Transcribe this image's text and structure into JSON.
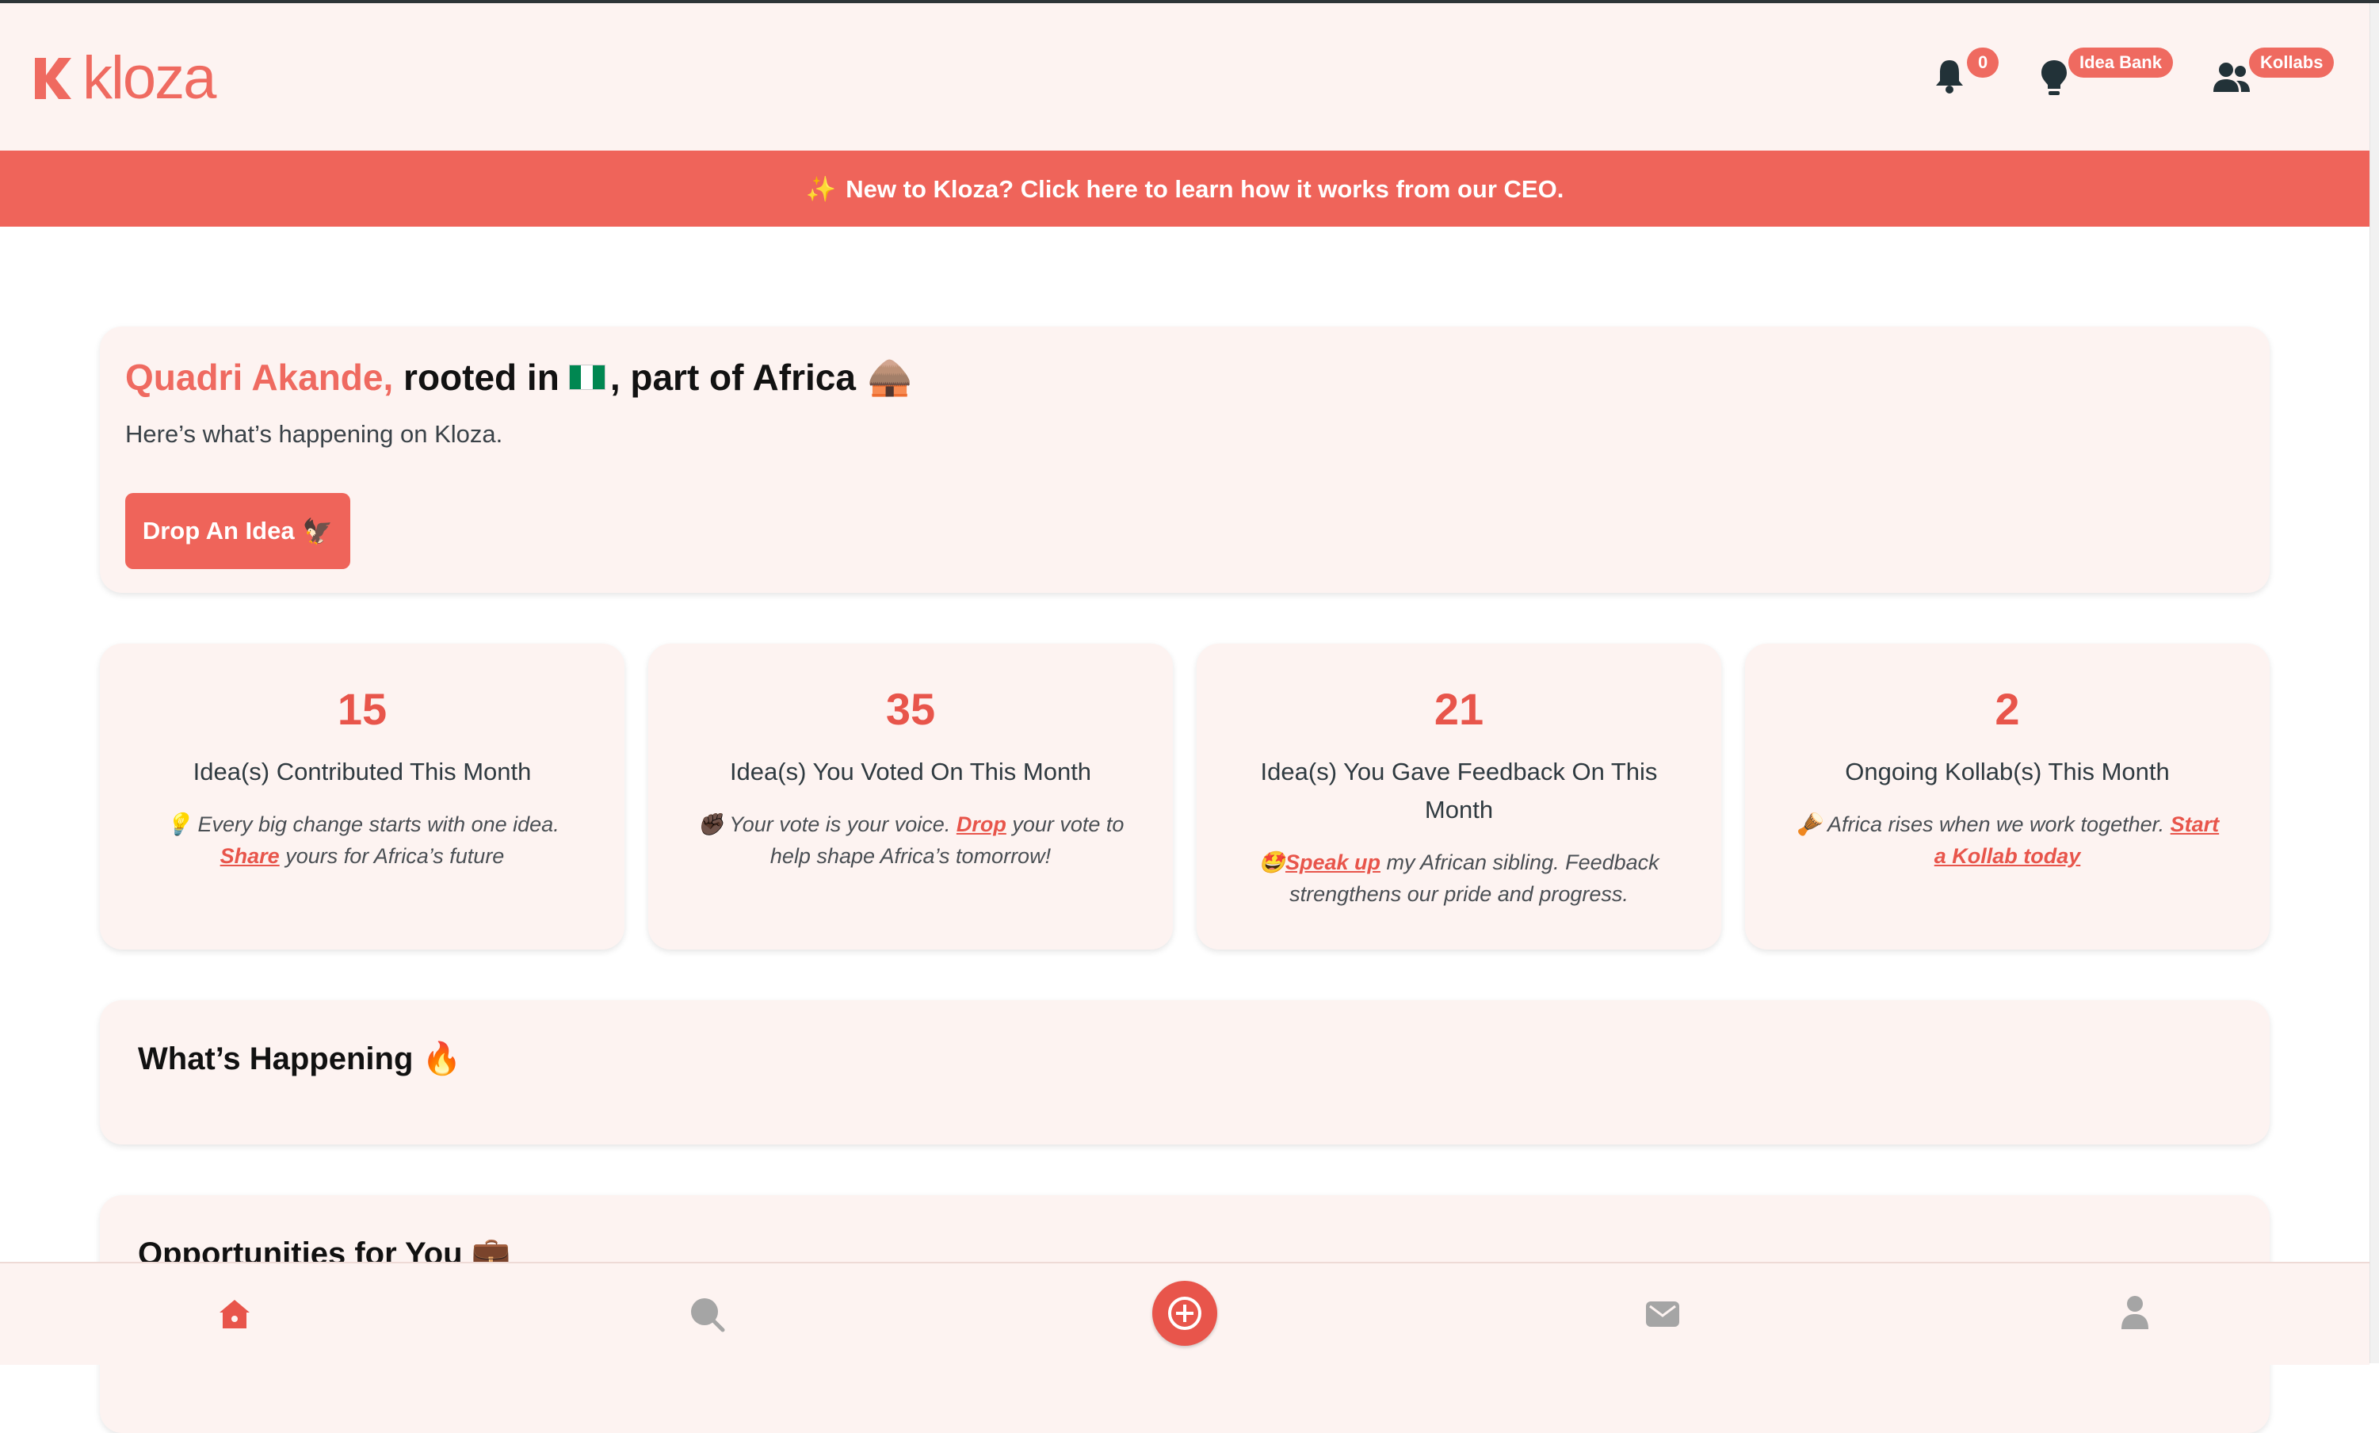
{
  "brand": {
    "name": "kloza",
    "color": "#ef6a60"
  },
  "header": {
    "notifications": {
      "icon": "bell-icon",
      "count": "0"
    },
    "idea_bank": {
      "icon": "lightbulb-icon",
      "label": "Idea Bank"
    },
    "kollabs": {
      "icon": "users-icon",
      "label": "Kollabs"
    }
  },
  "banner": {
    "text": "New to Kloza? Click here to learn how it works from our CEO.",
    "sparkle": "✨"
  },
  "welcome": {
    "name": "Quadri Akande,",
    "rooted": "rooted in",
    "africa": ", part of Africa",
    "hut": "🛖",
    "subtitle": "Here’s what’s happening on Kloza.",
    "drop_button": "Drop An Idea",
    "drop_icon": "🦅"
  },
  "stats": [
    {
      "value": "15",
      "label": "Idea(s) Contributed This Month",
      "icon": "💡",
      "pre": "Every big change starts with one idea.",
      "link": "Share",
      "post": "yours for Africa’s future"
    },
    {
      "value": "35",
      "label": "Idea(s) You Voted On This Month",
      "icon": "✊🏿",
      "pre": "Your vote is your voice.",
      "link": "Drop",
      "post": "your vote to help shape Africa’s tomorrow!"
    },
    {
      "value": "21",
      "label": "Idea(s) You Gave Feedback On This Month",
      "icon": "🤩",
      "pre": "",
      "link": "Speak up",
      "post": "my African sibling. Feedback strengthens our pride and progress."
    },
    {
      "value": "2",
      "label": "Ongoing Kollab(s) This Month",
      "icon": "🪘",
      "pre": "Africa rises when we work together.",
      "link": "Start a Kollab today",
      "post": ""
    }
  ],
  "sections": {
    "happening": {
      "title": "What’s Happening",
      "icon": "🔥"
    },
    "opportunities": {
      "title": "Opportunities for You",
      "icon": "💼"
    }
  },
  "bottom_nav": [
    "home-icon",
    "search-icon",
    "plus-icon",
    "mail-icon",
    "profile-icon"
  ],
  "colors": {
    "accent": "#ef645a",
    "card_bg": "#fdf3f1",
    "flag_green": "#008751"
  }
}
